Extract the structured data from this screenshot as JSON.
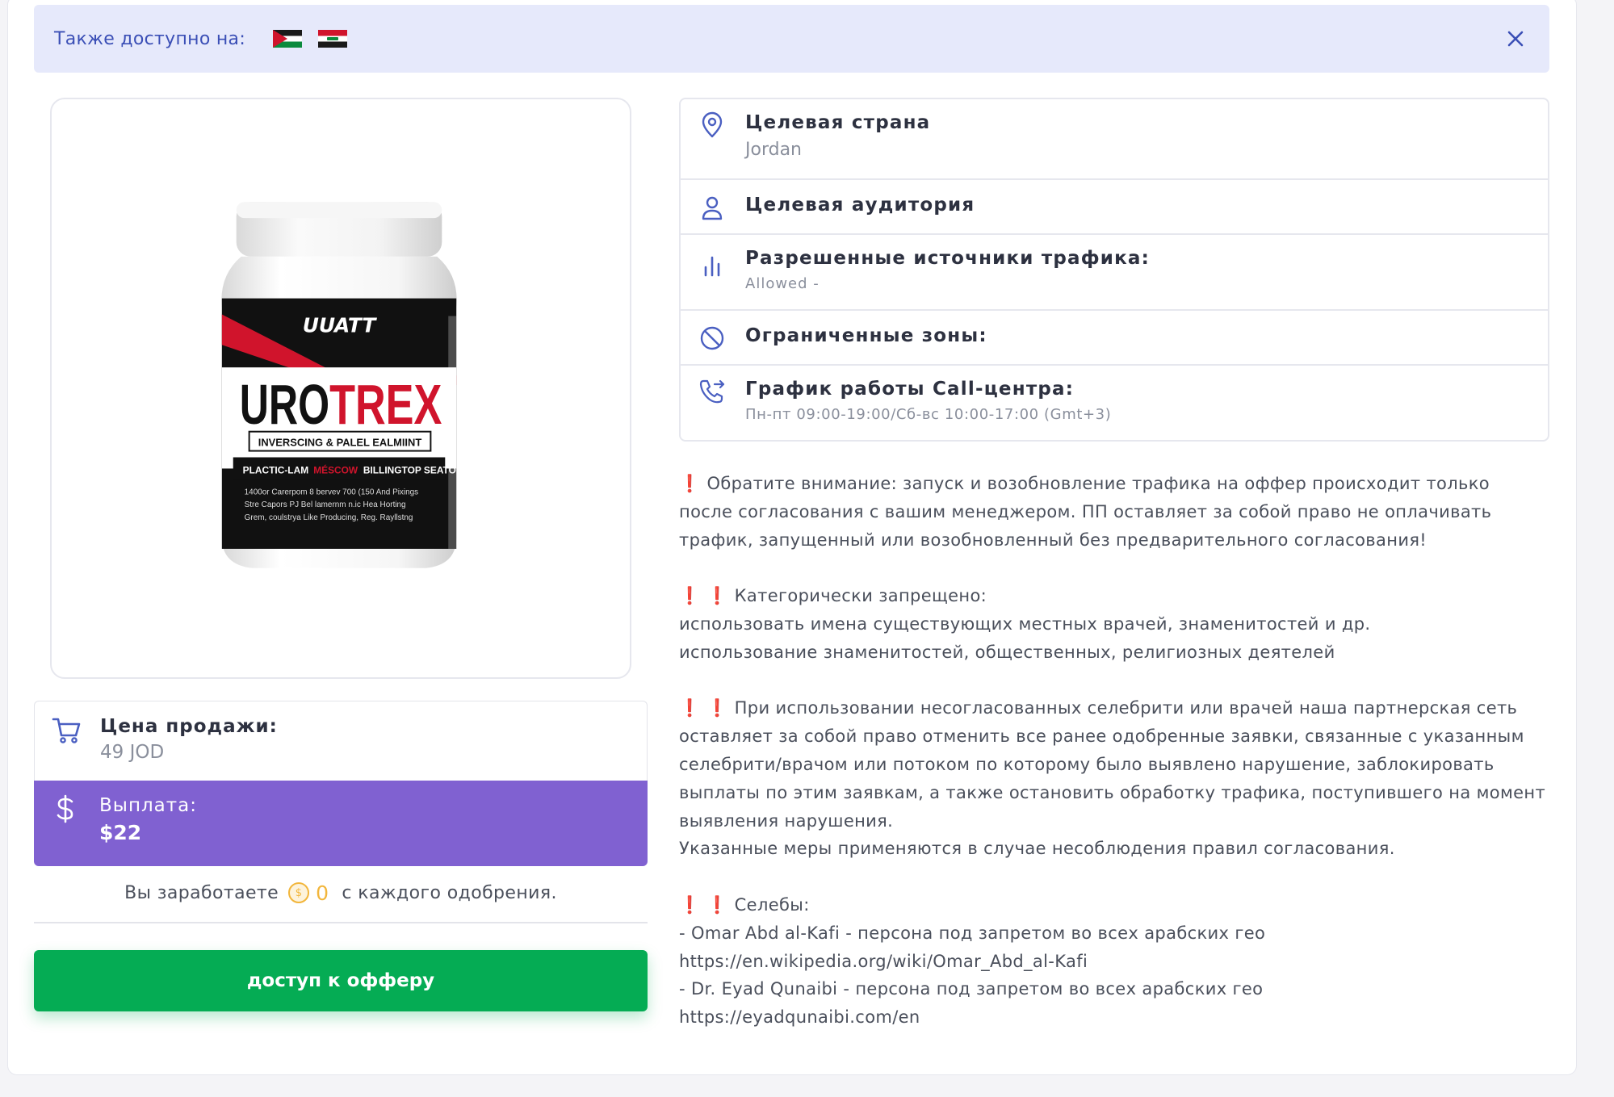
{
  "banner": {
    "label": "Также доступно на:",
    "flags": [
      "jordan-flag",
      "iraq-flag"
    ]
  },
  "product": {
    "brand": "UUATT",
    "name_part1": "URO",
    "name_part2": "TREX",
    "tagline": "INVERSCING & PALEL EALMIINT",
    "strip": [
      "PLACTIC-LAM",
      "MÉSCOW",
      "BILLINGTOP SEATONE"
    ],
    "bullets": [
      "1400or Carerpom 8 bervev 700 (150 And Pixings",
      "Stre Capors PJ Bel lamernm n.ic Hea Horting",
      "Grem, coulstrya Like Producing, Reg. Rayllstng"
    ]
  },
  "price": {
    "title": "Цена продажи:",
    "value": "49 JOD"
  },
  "payout": {
    "title": "Выплата:",
    "value": "$22"
  },
  "earn": {
    "prefix": "Вы заработаете",
    "amount": "0",
    "suffix": "с каждого одобрения."
  },
  "cta": {
    "label": "доступ к офферу"
  },
  "info": {
    "country_title": "Целевая страна",
    "country_value": "Jordan",
    "audience_title": "Целевая аудитория",
    "traffic_title": "Разрешенные источники трафика:",
    "traffic_value": "Allowed -",
    "zones_title": "Ограниченные зоны:",
    "callcenter_title": "График работы Call-центра:",
    "callcenter_value": "Пн-пт 09:00-19:00/Сб-вс 10:00-17:00 (Gmt+3)"
  },
  "notes": {
    "p1_lines": [
      "Обратите внимание: запуск и возобновление трафика на оффер происходит только",
      "после согласования с вашим менеджером. ПП оставляет за собой право не оплачивать",
      "трафик, запущенный или возобновленный без предварительного согласования!"
    ],
    "p2_lines": [
      "Категорически запрещено:",
      "использовать имена существующих местных врачей, знаменитостей и др.",
      "использование знаменитостей, общественных, религиозных деятелей"
    ],
    "p3_lines": [
      "При использовании несогласованных селебрити или врачей наша партнерская сеть",
      "оставляет за собой право отменить все ранее одобренные заявки, связанные с указанным",
      "селебрити/врачом или потоком по которому было выявлено нарушение, заблокировать",
      "выплаты по этим заявкам, а также остановить обработку трафика, поступившего на момент",
      "выявления нарушения.",
      "Указанные меры применяются в случае несоблюдения правил согласования."
    ],
    "p4_lines": [
      "Селебы:",
      "- Omar Abd al-Kafi - персона под запретом во всех арабских гео",
      "https://en.wikipedia.org/wiki/Omar_Abd_al-Kafi",
      "- Dr. Eyad Qunaibi - персона под запретом во всех арабских гео",
      "https://eyadqunaibi.com/en"
    ]
  },
  "colors": {
    "accent": "#8061d1",
    "cta": "#05ac54",
    "banner_bg": "#e6e9fb",
    "banner_text": "#3b4fb6",
    "icon": "#4a5fc1",
    "warning": "#e21b1b"
  }
}
